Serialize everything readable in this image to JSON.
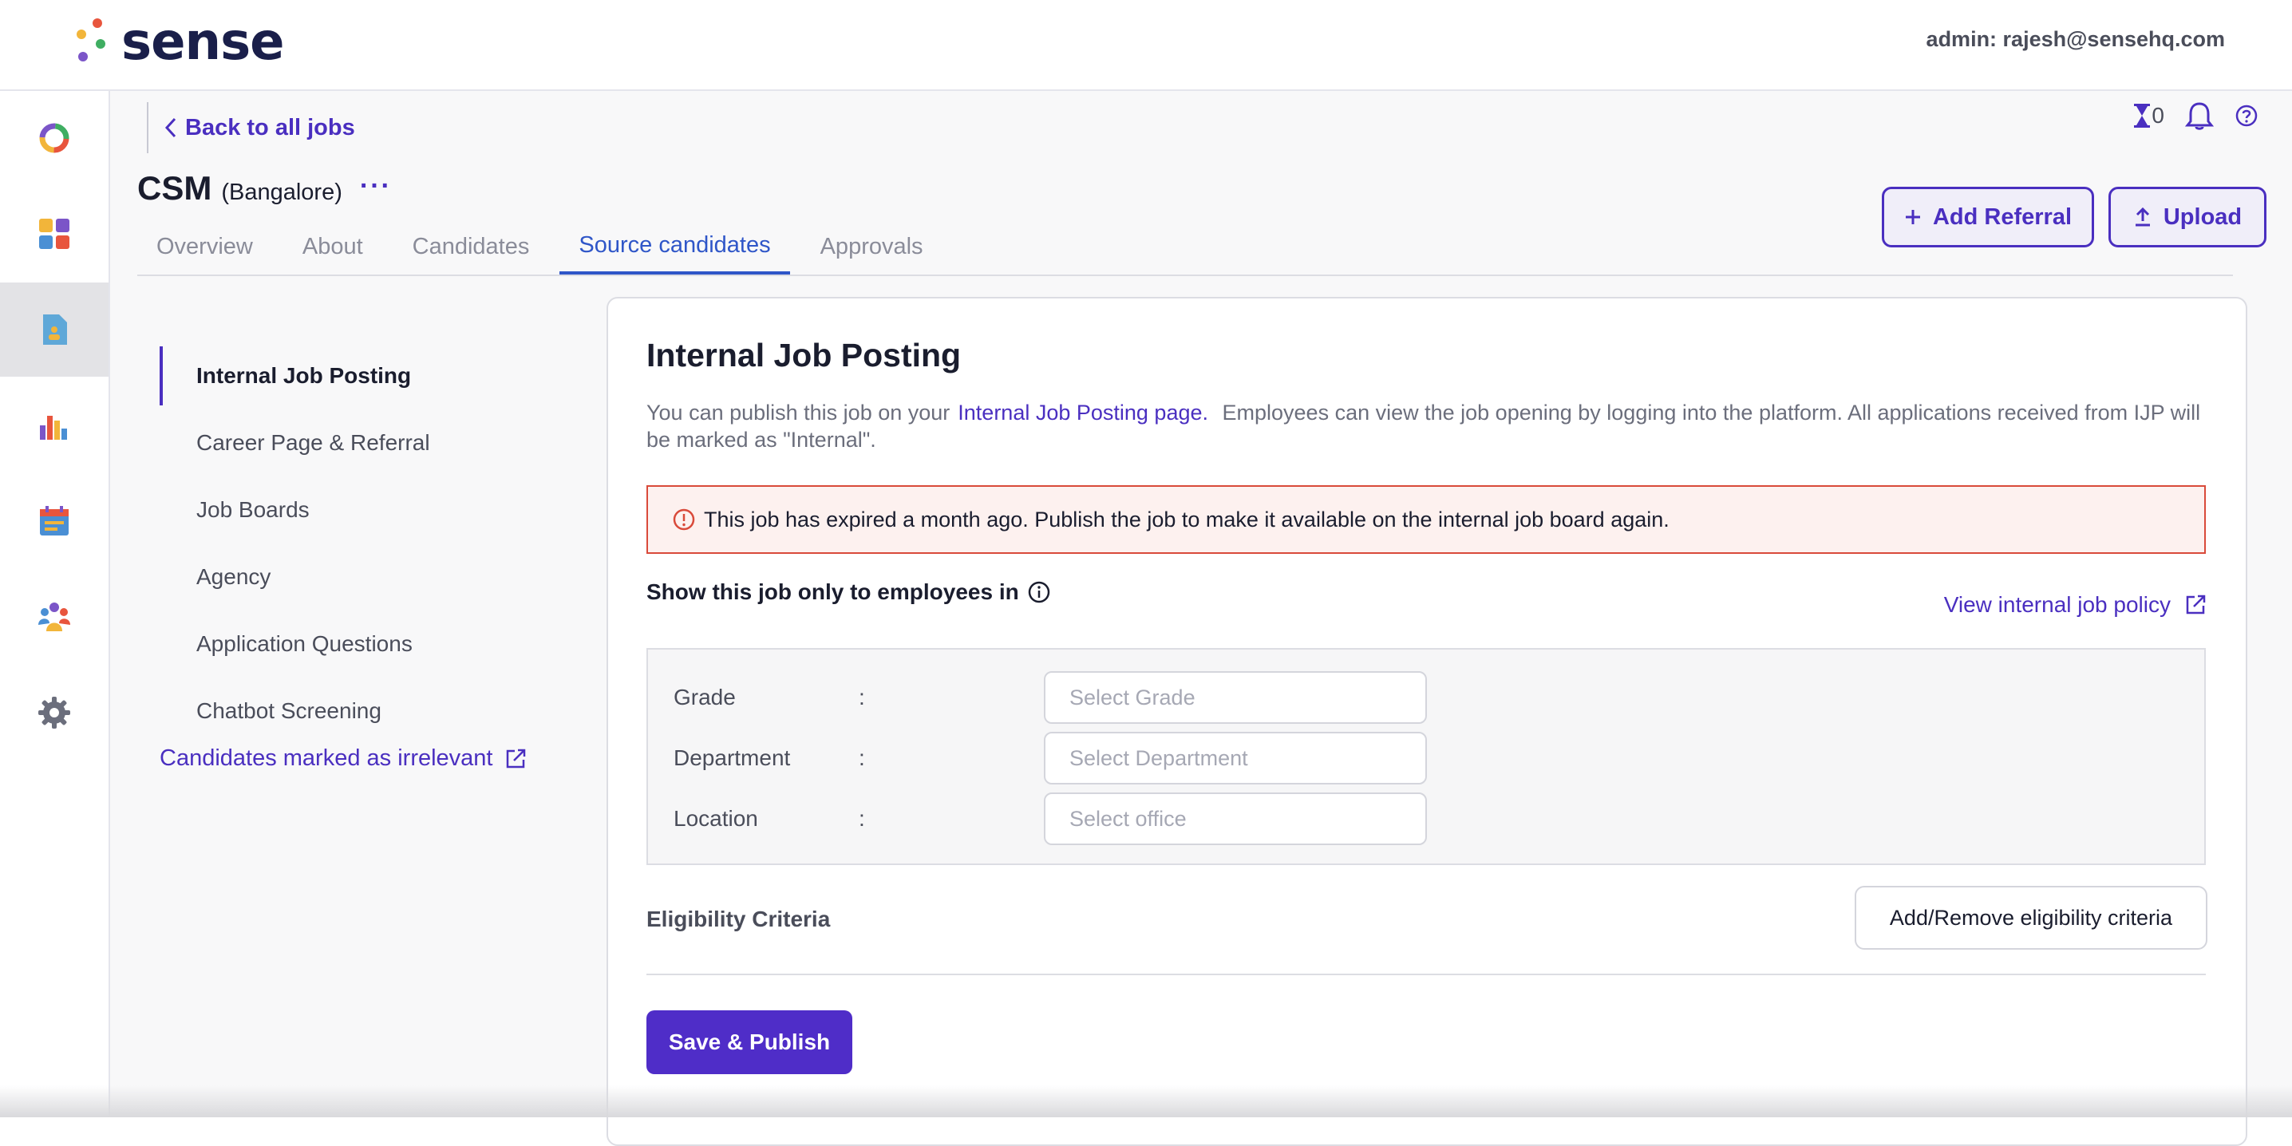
{
  "header": {
    "logo_text": "sense",
    "admin_email": "admin: rajesh@sensehq.com"
  },
  "topbar": {
    "back_link": "Back to all jobs",
    "pending_count": "0"
  },
  "job": {
    "title": "CSM",
    "location": "(Bangalore)",
    "more": "···"
  },
  "actions": {
    "add_referral": "Add Referral",
    "upload": "Upload"
  },
  "tabs": [
    {
      "label": "Overview"
    },
    {
      "label": "About"
    },
    {
      "label": "Candidates"
    },
    {
      "label": "Source candidates",
      "active": true
    },
    {
      "label": "Approvals"
    }
  ],
  "subnav": {
    "items": [
      {
        "label": "Internal Job Posting",
        "active": true
      },
      {
        "label": "Career Page & Referral"
      },
      {
        "label": "Job Boards"
      },
      {
        "label": "Agency"
      },
      {
        "label": "Application Questions"
      },
      {
        "label": "Chatbot Screening"
      }
    ],
    "irrelevant_link": "Candidates marked as irrelevant"
  },
  "ijp": {
    "title": "Internal Job Posting",
    "desc_before": "You can publish this job on your",
    "desc_link": "Internal Job Posting page.",
    "desc_after": " Employees can view the job opening by logging into the platform. All applications received from IJP will be marked as \"Internal\".",
    "alert": "This job has expired a month ago. Publish the job to make it available on the internal job board again.",
    "show_label": "Show this job only to employees in",
    "policy_link": "View internal job policy",
    "filters": [
      {
        "label": "Grade",
        "colon": ":",
        "placeholder": "Select Grade"
      },
      {
        "label": "Department",
        "colon": ":",
        "placeholder": "Select Department"
      },
      {
        "label": "Location",
        "colon": ":",
        "placeholder": "Select office"
      }
    ],
    "eligibility_label": "Eligibility Criteria",
    "eligibility_button": "Add/Remove eligibility criteria",
    "save_button": "Save & Publish"
  },
  "colors": {
    "accent": "#4a2fc0",
    "tab_active": "#2f56c8",
    "alert_border": "#d94a3a",
    "primary_button": "#4f2dc8"
  },
  "icons": {
    "rail": [
      "overview-ring-icon",
      "dashboard-grid-icon",
      "jobs-document-icon",
      "analytics-bars-icon",
      "calendar-icon",
      "people-group-icon",
      "settings-gear-icon"
    ],
    "top": [
      "hourglass-icon",
      "bell-icon",
      "help-icon"
    ]
  }
}
